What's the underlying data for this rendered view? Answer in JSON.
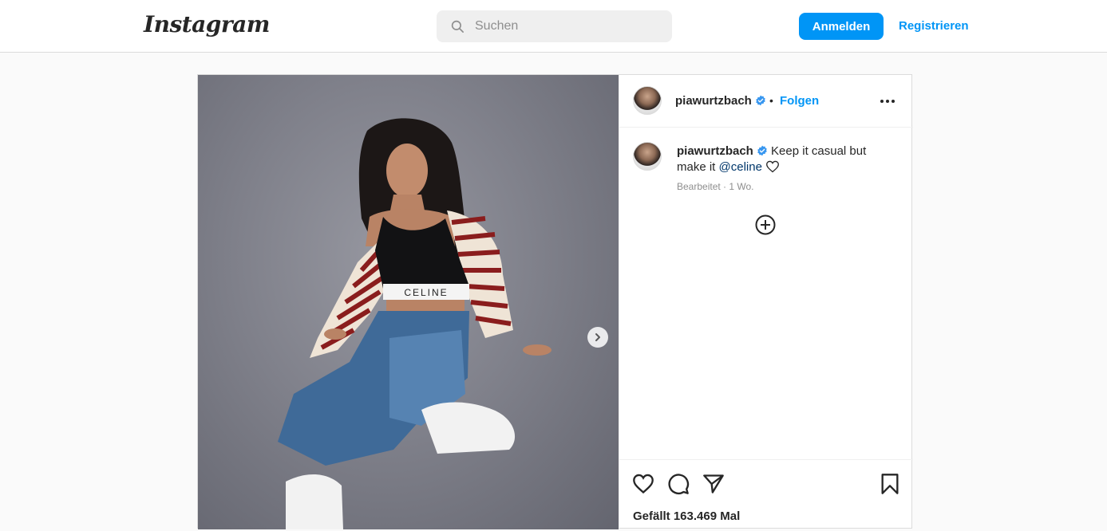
{
  "header": {
    "logo": "Instagram",
    "search_placeholder": "Suchen",
    "login_label": "Anmelden",
    "register_label": "Registrieren"
  },
  "colors": {
    "accent": "#0095f6",
    "mention": "#00376b",
    "verified": "#3897f0"
  },
  "post": {
    "username": "piawurtzbach",
    "separator": "•",
    "follow_label": "Folgen",
    "caption_user": "piawurtzbach",
    "caption_text": "Keep it casual but make it",
    "caption_mention": "@celine",
    "meta": "Bearbeitet · 1 Wo.",
    "likes": "Gefällt 163.469 Mal"
  },
  "icons": [
    "search-icon",
    "verified-badge-icon",
    "more-options-icon",
    "heart-icon",
    "comment-icon",
    "share-icon",
    "bookmark-icon",
    "plus-circle-icon",
    "chevron-right-icon"
  ]
}
